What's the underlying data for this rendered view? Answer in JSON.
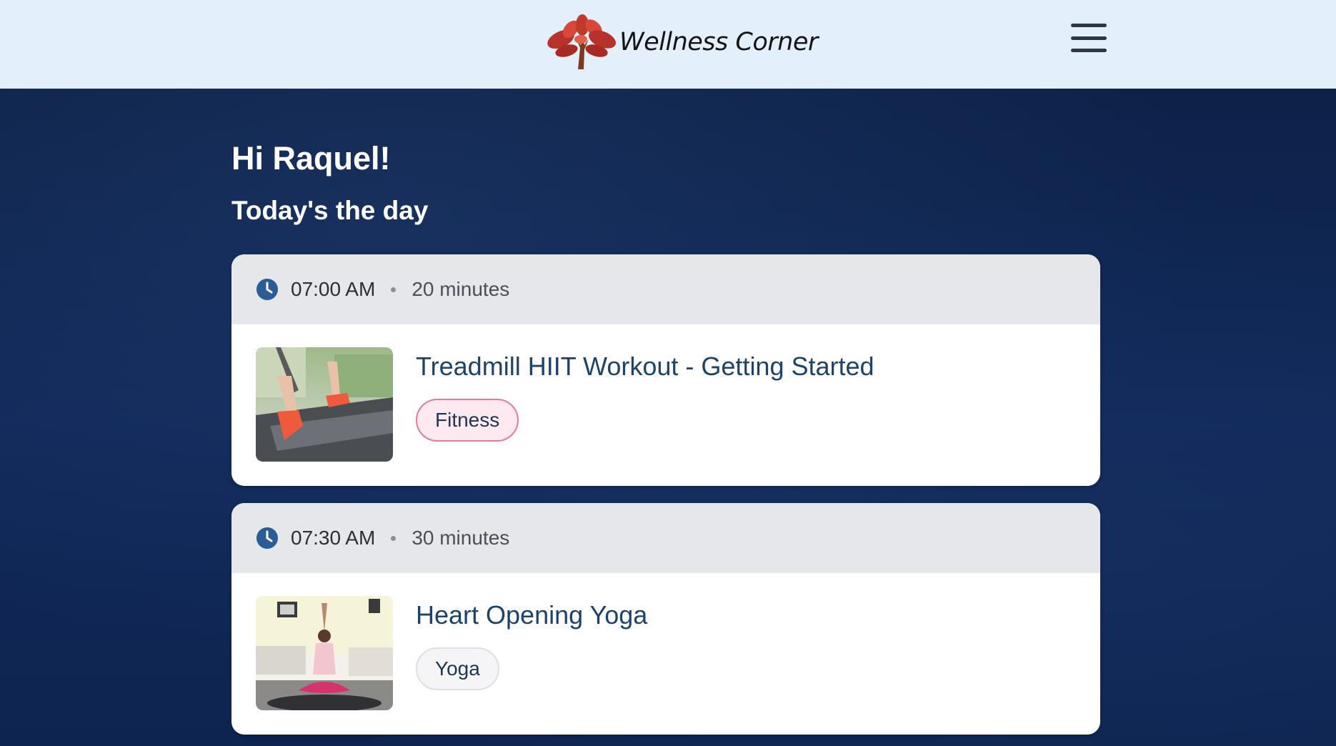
{
  "header": {
    "brand": "Wellness Corner",
    "logo_icon": "tree-logo-icon",
    "menu_icon": "hamburger-menu-icon"
  },
  "main": {
    "greeting": "Hi Raquel!",
    "subheading": "Today's the day"
  },
  "sessions": [
    {
      "time": "07:00 AM",
      "duration": "20 minutes",
      "title": "Treadmill HIIT Workout - Getting Started",
      "tag": "Fitness",
      "thumbnail": "treadmill-runner-thumbnail"
    },
    {
      "time": "07:30 AM",
      "duration": "30 minutes",
      "title": "Heart Opening Yoga",
      "tag": "Yoga",
      "thumbnail": "yoga-pose-thumbnail"
    }
  ],
  "colors": {
    "header_bg": "#e3effb",
    "page_bg": "#0e2449",
    "clock_icon": "#2a5d96",
    "title_text": "#1d4468",
    "fitness_tag_border": "#e57a9b"
  }
}
